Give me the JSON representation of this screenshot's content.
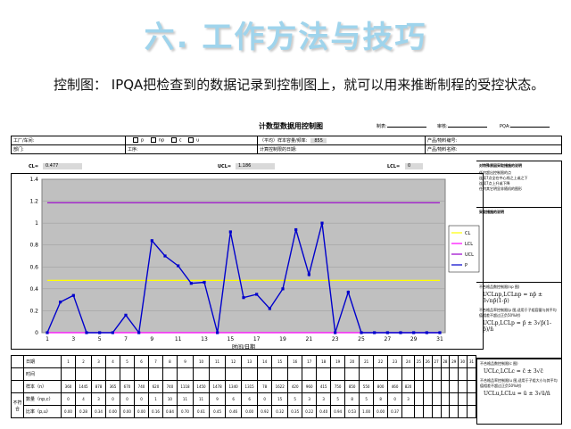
{
  "slide": {
    "title": "六. 工作方法与技巧",
    "intro": "控制图： IPQA把检查到的数据记录到控制图上，就可以用来推断制程的受控状态。"
  },
  "form": {
    "title": "计数型数据用控制图",
    "made_label": "制表:",
    "review_label": "审核:",
    "pqa_label": "PQA:",
    "workshop_label": "工厂/车间:",
    "type_options": [
      "p",
      "np",
      "c",
      "u"
    ],
    "sample_size_label": "（平均）样本容量/频率:",
    "sample_size_value": "855",
    "product_no_label": "产品/物料编号:",
    "dept_label": "部门:",
    "process_label": "工序:",
    "calc_date_label": "计算控制限的日期:",
    "product_name_label": "产品/物料名称:",
    "cl_label": "CL=",
    "cl_value": "0.477",
    "ucl_label": "UCL=",
    "ucl_value": "1.186",
    "lcl_label": "LCL=",
    "lcl_value": "0",
    "xlabel": "时间/日期"
  },
  "side_notes": {
    "h1": "对特殊原因采取措施的说明",
    "items": [
      "任何超出控制限的点",
      "连续7点全在中心线之上或之下",
      "连续7点上升或下降",
      "任何其它明显非随机的图形"
    ],
    "h2": "采取措施的说明",
    "np_title": "不合格品数控制限(np 图)",
    "np_formula": "UCLnp,LCLnp = np̄ ± 3√np̄(1-p̄)",
    "p_title": "不合格品率控制限(p 图,适用于子组容量与其平均值相差不超过正负50%时)",
    "p_formula": "UCLp,LCLp = p̄ ± 3√p̄(1-p̄)/n̄",
    "c_title": "不合格品数控制限(c 图)",
    "c_formula": "UCLc,LCLc = c̄ ± 3√c̄",
    "u_title": "不合格品率控制限(u 图,适用于子组大小与其平均值相差不超过正负50%时)",
    "u_formula": "UCLu,LCLu = ū ± 3√ū/n̄"
  },
  "table": {
    "row_date": "日期",
    "row_time": "时间",
    "row_sample": "样本（n）",
    "row_count": "数量（np,c）",
    "row_rate": "比率（p,u）",
    "group_label": "不符合",
    "days": [
      "1",
      "2",
      "3",
      "4",
      "5",
      "6",
      "7",
      "8",
      "9",
      "10",
      "11",
      "12",
      "13",
      "14",
      "15",
      "16",
      "17",
      "18",
      "19",
      "20",
      "21",
      "22",
      "23",
      "24",
      "25",
      "26",
      "27",
      "28",
      "29",
      "30",
      "31"
    ],
    "samples": [
      "360",
      "1445",
      "878",
      "365",
      "670",
      "740",
      "620",
      "740",
      "1118",
      "1450",
      "1478",
      "1340",
      "1315",
      "78",
      "1622",
      "420",
      "960",
      "415",
      "750",
      "850",
      "550",
      "800",
      "460",
      "820",
      "",
      "",
      "",
      "",
      "",
      "",
      ""
    ],
    "counts": [
      "0",
      "4",
      "3",
      "0",
      "0",
      "0",
      "1",
      "10",
      "11",
      "11",
      "9",
      "6",
      "6",
      "0",
      "15",
      "5",
      "3",
      "3",
      "5",
      "8",
      "5",
      "8",
      "0",
      "3",
      "",
      "",
      "",
      "",
      "",
      "",
      ""
    ],
    "rates": [
      "0.00",
      "0.28",
      "0.34",
      "0.00",
      "0.00",
      "0.00",
      "0.16",
      "0.84",
      "0.70",
      "0.61",
      "0.45",
      "0.46",
      "0.00",
      "0.92",
      "0.32",
      "0.35",
      "0.22",
      "0.40",
      "0.94",
      "0.53",
      "1.00",
      "0.00",
      "0.37",
      "",
      "",
      "",
      "",
      "",
      "",
      "",
      ""
    ]
  },
  "chart_data": {
    "type": "line",
    "x": [
      1,
      2,
      3,
      4,
      5,
      6,
      7,
      8,
      9,
      10,
      11,
      12,
      13,
      14,
      15,
      16,
      17,
      18,
      19,
      20,
      21,
      22,
      23,
      24,
      25,
      26,
      27,
      28,
      29,
      30,
      31
    ],
    "xticks": [
      "1",
      "3",
      "5",
      "7",
      "9",
      "11",
      "13",
      "15",
      "17",
      "19",
      "21",
      "23",
      "25",
      "27",
      "29",
      "31"
    ],
    "ylim": [
      0,
      1.4
    ],
    "yticks": [
      "0",
      "0.2",
      "0.4",
      "0.6",
      "0.8",
      "1",
      "1.2",
      "1.4"
    ],
    "xlabel": "时间/日期",
    "series": [
      {
        "name": "CL",
        "color": "#ffff00",
        "values": [
          0.477,
          0.477,
          0.477,
          0.477,
          0.477,
          0.477,
          0.477,
          0.477,
          0.477,
          0.477,
          0.477,
          0.477,
          0.477,
          0.477,
          0.477,
          0.477,
          0.477,
          0.477,
          0.477,
          0.477,
          0.477,
          0.477,
          0.477,
          0.477,
          0.477,
          0.477,
          0.477,
          0.477,
          0.477,
          0.477,
          0.477
        ]
      },
      {
        "name": "LCL",
        "color": "#ff00ff",
        "values": [
          0,
          0,
          0,
          0,
          0,
          0,
          0,
          0,
          0,
          0,
          0,
          0,
          0,
          0,
          0,
          0,
          0,
          0,
          0,
          0,
          0,
          0,
          0,
          0,
          0,
          0,
          0,
          0,
          0,
          0,
          0
        ]
      },
      {
        "name": "UCL",
        "color": "#9900cc",
        "values": [
          1.186,
          1.186,
          1.186,
          1.186,
          1.186,
          1.186,
          1.186,
          1.186,
          1.186,
          1.186,
          1.186,
          1.186,
          1.186,
          1.186,
          1.186,
          1.186,
          1.186,
          1.186,
          1.186,
          1.186,
          1.186,
          1.186,
          1.186,
          1.186,
          1.186,
          1.186,
          1.186,
          1.186,
          1.186,
          1.186,
          1.186
        ]
      },
      {
        "name": "P",
        "color": "#0000cc",
        "values": [
          0,
          0.28,
          0.34,
          0,
          0,
          0,
          0.16,
          0,
          0.84,
          0.7,
          0.61,
          0.45,
          0.46,
          0,
          0.92,
          0.32,
          0.35,
          0.22,
          0.4,
          0.94,
          0.53,
          1.0,
          0,
          0.37,
          0,
          0,
          0,
          0,
          0,
          0,
          0
        ]
      }
    ],
    "legend": "right"
  }
}
